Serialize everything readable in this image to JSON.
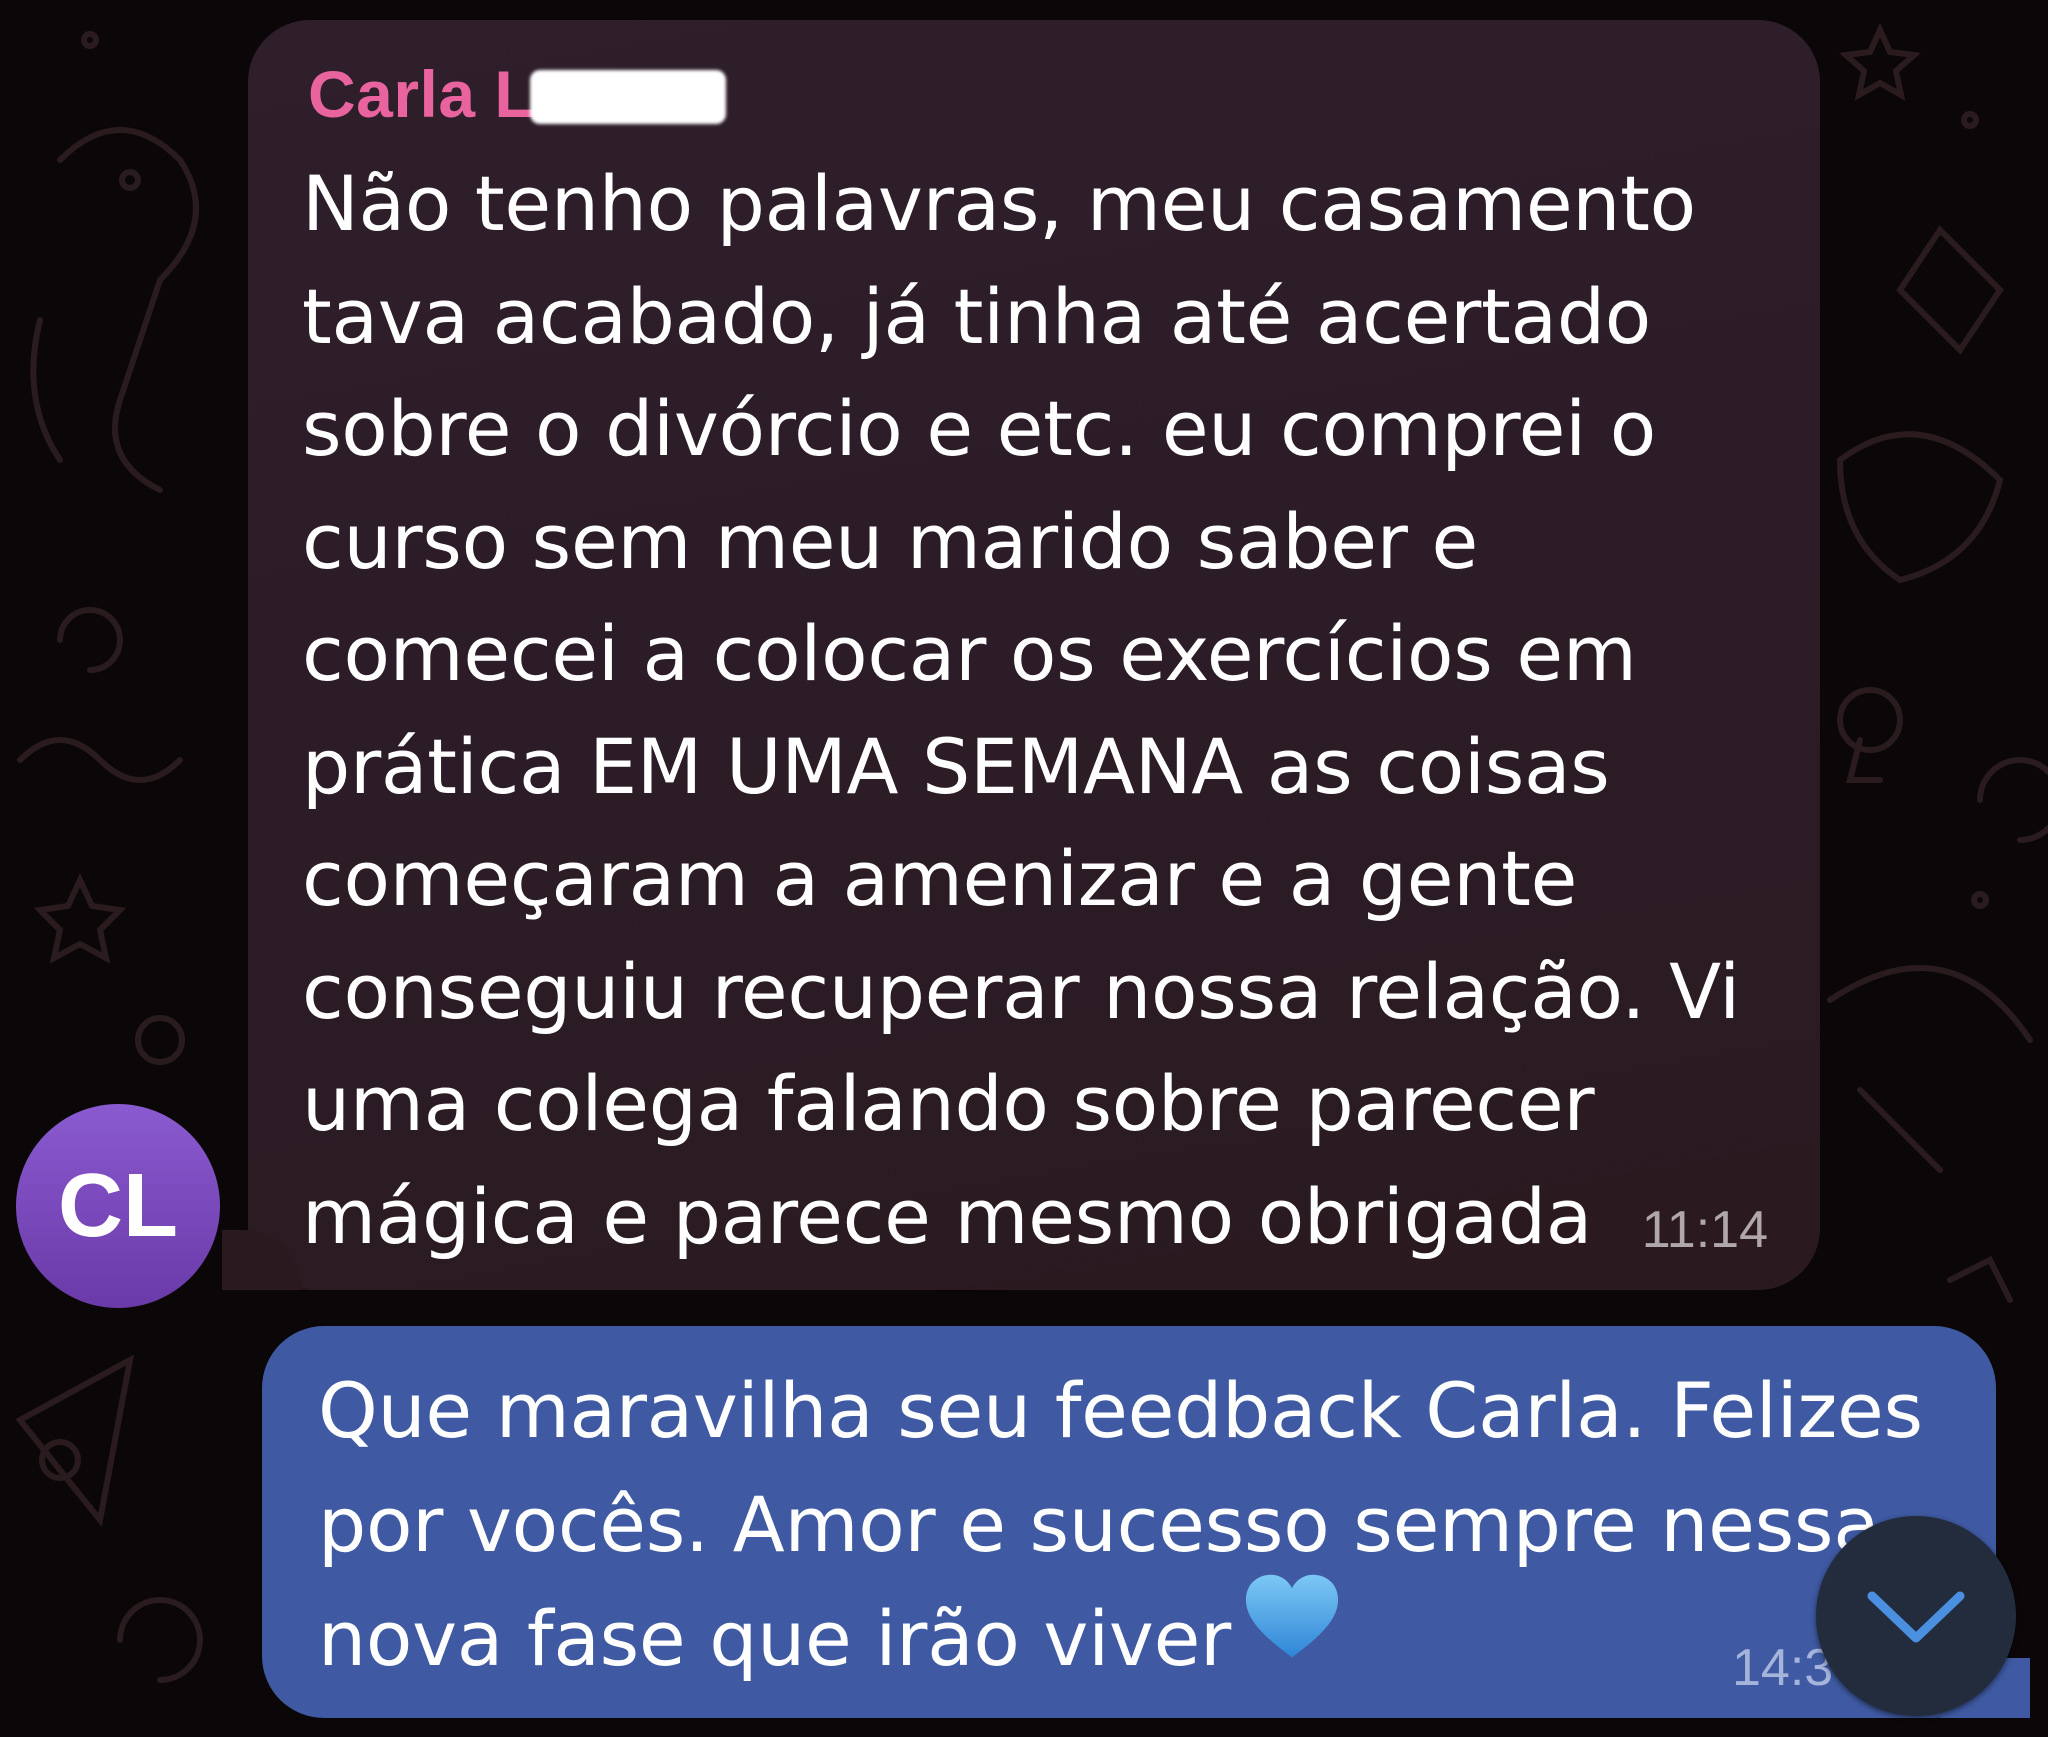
{
  "incoming": {
    "sender_name": "Carla L   s",
    "text": "Não tenho palavras, meu casamento\ntava acabado, já tinha até acertado\nsobre o divórcio e etc. eu comprei o\ncurso sem meu marido saber e\ncomecei a colocar os exercícios em\nprática EM UMA SEMANA as coisas\ncomeçaram a amenizar e a gente\nconseguiu recuperar nossa relação. Vi\numa colega falando sobre parecer\nmágica e parece mesmo obrigada",
    "time": "11:14",
    "avatar_initials": "CL"
  },
  "outgoing": {
    "text": "Que maravilha seu feedback Carla. Felizes\npor vocês. Amor e sucesso sempre nessa\nnova fase que irão viver",
    "emoji": "blue-heart-icon",
    "time": "14:3"
  },
  "colors": {
    "sender_name": "#e9649f",
    "incoming_bubble": "#2c1c28",
    "outgoing_bubble": "#3f5aa3",
    "avatar": "#7a4ab8",
    "scroll_button": "#232c3c"
  },
  "scroll_button_icon": "chevron-down-icon"
}
